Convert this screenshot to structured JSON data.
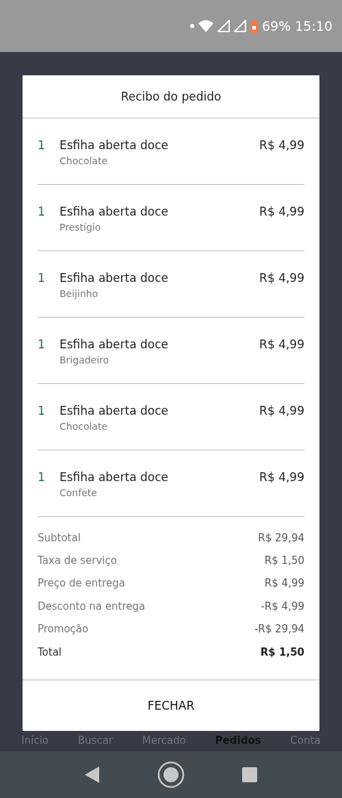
{
  "status_bar": {
    "battery": "69%",
    "time": "15:10"
  },
  "bottom_nav": [
    {
      "label": "Início",
      "selected": false
    },
    {
      "label": "Buscar",
      "selected": false
    },
    {
      "label": "Mercado",
      "selected": false
    },
    {
      "label": "Pedidos",
      "selected": true
    },
    {
      "label": "Conta",
      "selected": false
    }
  ],
  "dialog": {
    "title": "Recibo do pedido",
    "items": [
      {
        "quantity": "1",
        "name": "Esfiha aberta doce",
        "option": "Chocolate",
        "price": "R$ 4,99"
      },
      {
        "quantity": "1",
        "name": "Esfiha aberta doce",
        "option": "Prestígio",
        "price": "R$ 4,99"
      },
      {
        "quantity": "1",
        "name": "Esfiha aberta doce",
        "option": "Beijinho",
        "price": "R$ 4,99"
      },
      {
        "quantity": "1",
        "name": "Esfiha aberta doce",
        "option": "Brigadeiro",
        "price": "R$ 4,99"
      },
      {
        "quantity": "1",
        "name": "Esfiha aberta doce",
        "option": "Chocolate",
        "price": "R$ 4,99"
      },
      {
        "quantity": "1",
        "name": "Esfiha aberta doce",
        "option": "Confete",
        "price": "R$ 4,99"
      }
    ],
    "summary": [
      {
        "label": "Subtotal",
        "value": "R$ 29,94",
        "kind": "line"
      },
      {
        "label": "Taxa de serviço",
        "value": "R$ 1,50",
        "kind": "line"
      },
      {
        "label": "Preço de entrega",
        "value": "R$ 4,99",
        "kind": "line"
      },
      {
        "label": "Desconto na entrega",
        "value": "-R$ 4,99",
        "kind": "line"
      },
      {
        "label": "Promoção",
        "value": "-R$ 29,94",
        "kind": "line"
      },
      {
        "label": "Total",
        "value": "R$ 1,50",
        "kind": "total"
      }
    ],
    "close_button": "FECHAR"
  }
}
